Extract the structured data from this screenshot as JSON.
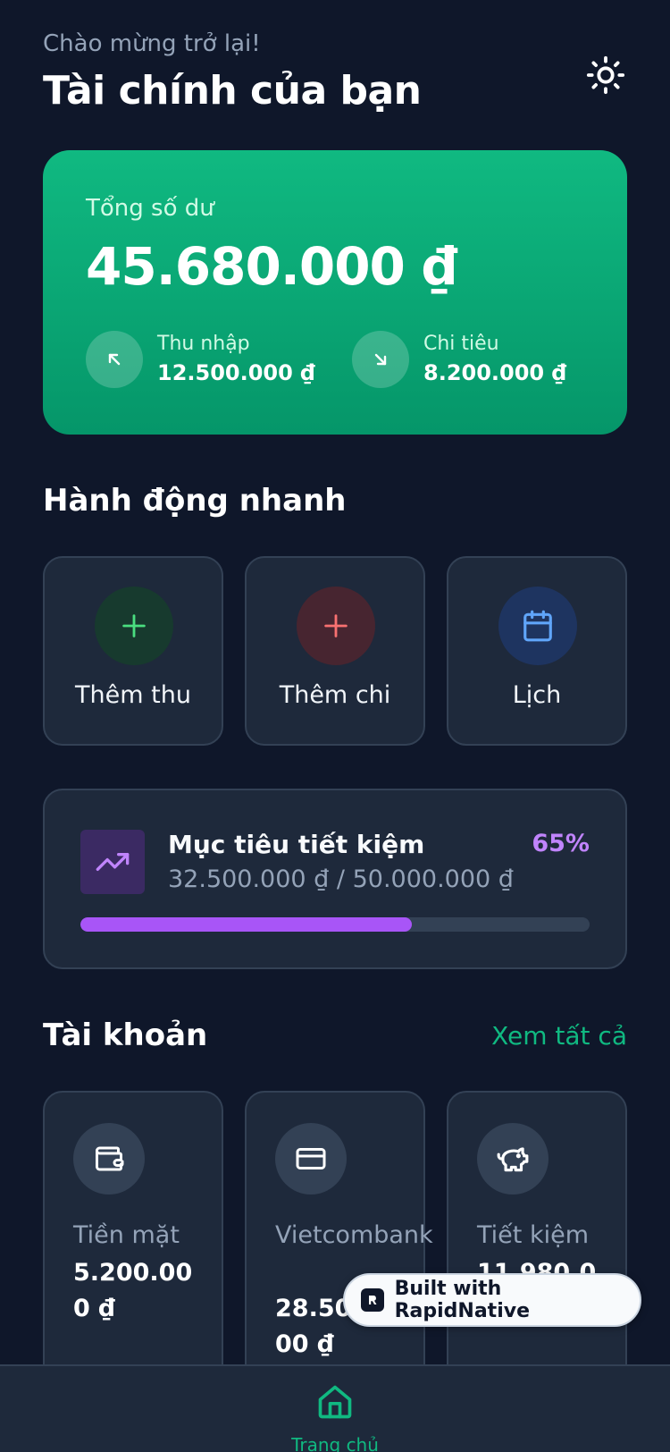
{
  "header": {
    "greeting": "Chào mừng trở lại!",
    "title": "Tài chính của bạn",
    "theme_icon": "sun-icon"
  },
  "balance": {
    "label": "Tổng số dư",
    "value": "45.680.000 ₫",
    "income": {
      "label": "Thu nhập",
      "value": "12.500.000 ₫",
      "icon": "arrow-up-left-icon"
    },
    "expense": {
      "label": "Chi tiêu",
      "value": "8.200.000 ₫",
      "icon": "arrow-down-right-icon"
    },
    "colors": {
      "gradient_top": "#10b981",
      "gradient_bottom": "#059669"
    }
  },
  "quick_actions": {
    "title": "Hành động nhanh",
    "items": [
      {
        "label": "Thêm thu",
        "icon": "plus-icon",
        "color": "#4ade80"
      },
      {
        "label": "Thêm chi",
        "icon": "plus-icon",
        "color": "#f87171"
      },
      {
        "label": "Lịch",
        "icon": "calendar-icon",
        "color": "#60a5fa"
      }
    ]
  },
  "savings_goal": {
    "title": "Mục tiêu tiết kiệm",
    "amounts": "32.500.000 ₫ / 50.000.000 ₫",
    "percent_label": "65%",
    "progress": 0.65,
    "icon": "trending-up-icon",
    "color": "#a855f7"
  },
  "accounts": {
    "title": "Tài khoản",
    "see_all": "Xem tất cả",
    "items": [
      {
        "name": "Tiền mặt",
        "balance": "5.200.000 ₫",
        "icon": "wallet-icon"
      },
      {
        "name": "Vietcombank",
        "balance": "28.500.000 ₫",
        "icon": "credit-card-icon"
      },
      {
        "name": "Tiết kiệm",
        "balance": "11.980.000 ₫",
        "icon": "piggy-bank-icon"
      }
    ]
  },
  "badge": {
    "text": "Built with RapidNative"
  },
  "nav": {
    "home_label": "Trang chủ",
    "home_icon": "home-icon",
    "accent": "#10b981"
  }
}
